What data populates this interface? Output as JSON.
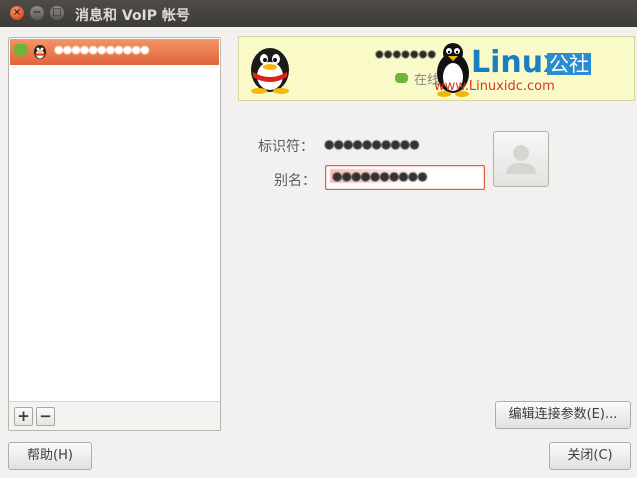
{
  "window": {
    "title": "消息和 VoIP 帐号",
    "close_glyph": "×",
    "minimize_glyph": "−",
    "maximize_glyph": "□"
  },
  "accounts": {
    "items": [
      {
        "name": "●●●●●●●●●●●",
        "status": "online",
        "protocol_icon": "qq-icon"
      }
    ],
    "add_label": "+",
    "remove_label": "−"
  },
  "banner": {
    "name": "●●●●●●●",
    "status_text": "在线",
    "watermark_brand": "Linux",
    "watermark_suffix": "公社",
    "watermark_url": "www.Linuxidc.com"
  },
  "details": {
    "identifier_label": "标识符：",
    "identifier_value": "●●●●●●●●●●",
    "alias_label": "别名：",
    "alias_value": "●●●●●●●●●●"
  },
  "buttons": {
    "edit_params": "编辑连接参数(E)...",
    "help": "帮助(H)",
    "close": "关闭(C)"
  },
  "colors": {
    "selection": "#e0643a",
    "banner_bg": "#fafac8",
    "online": "#6fb33a"
  }
}
